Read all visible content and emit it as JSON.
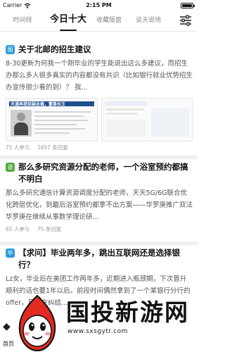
{
  "status_bar": {
    "carrier": "Carrier",
    "time": "2:15 PM"
  },
  "tabs": [
    {
      "label": "时间线"
    },
    {
      "label": "今日十大"
    },
    {
      "label": "收藏版面"
    },
    {
      "label": "谈天说地"
    }
  ],
  "posts": [
    {
      "badge": "图",
      "badge_color": "#2b9ad8",
      "title": "关于北邮的招生建议",
      "body": "8-30更新为何我一个刚毕业的学生能说出这么多建议，而招生办那么多人很多真实的内容都没有共识（比如银行就业优势招生办宣传很少看的到）？ 我...",
      "images": [
        {
          "caption": "天通再提前副总裁，董事长王"
        },
        {
          "caption": ""
        }
      ],
      "stats": {
        "people": "75 人参与",
        "replies": "1657 条回复"
      }
    },
    {
      "badge": "谈",
      "badge_color": "#52a83c",
      "title": "那么多研究资源分配的老师，一个浴室预约都搞不明白",
      "body": "那么多研究通信计算资源调度分配的老师，天天5G/6G联合优化跨层优化，到最后浴室预约都拿不出方案——华罗庚推广双法华罗庚在继续从事数学理论研...",
      "images": [],
      "stats": {
        "people": "65 人参与",
        "replies": "75 条回复"
      }
    },
    {
      "badge": "毕",
      "badge_color": "#2b9ad8",
      "title": "【求问】毕业两年多，跳出互联网还是选择银行？",
      "body": "Lz女，毕业后在美团工作两年多，近期进入瓶颈期，下次晋升顺利的话也要1年以后。前段时间偶然拿到了一个某银行分行的offer，目前在纠结...",
      "images": [],
      "stats": {
        "people": "",
        "replies": ""
      }
    }
  ],
  "bottom": {
    "left_glyph": "◆",
    "left_label": "首页",
    "brand_text": "国投新游网",
    "brand_url": "www.sxsgytr.com"
  }
}
